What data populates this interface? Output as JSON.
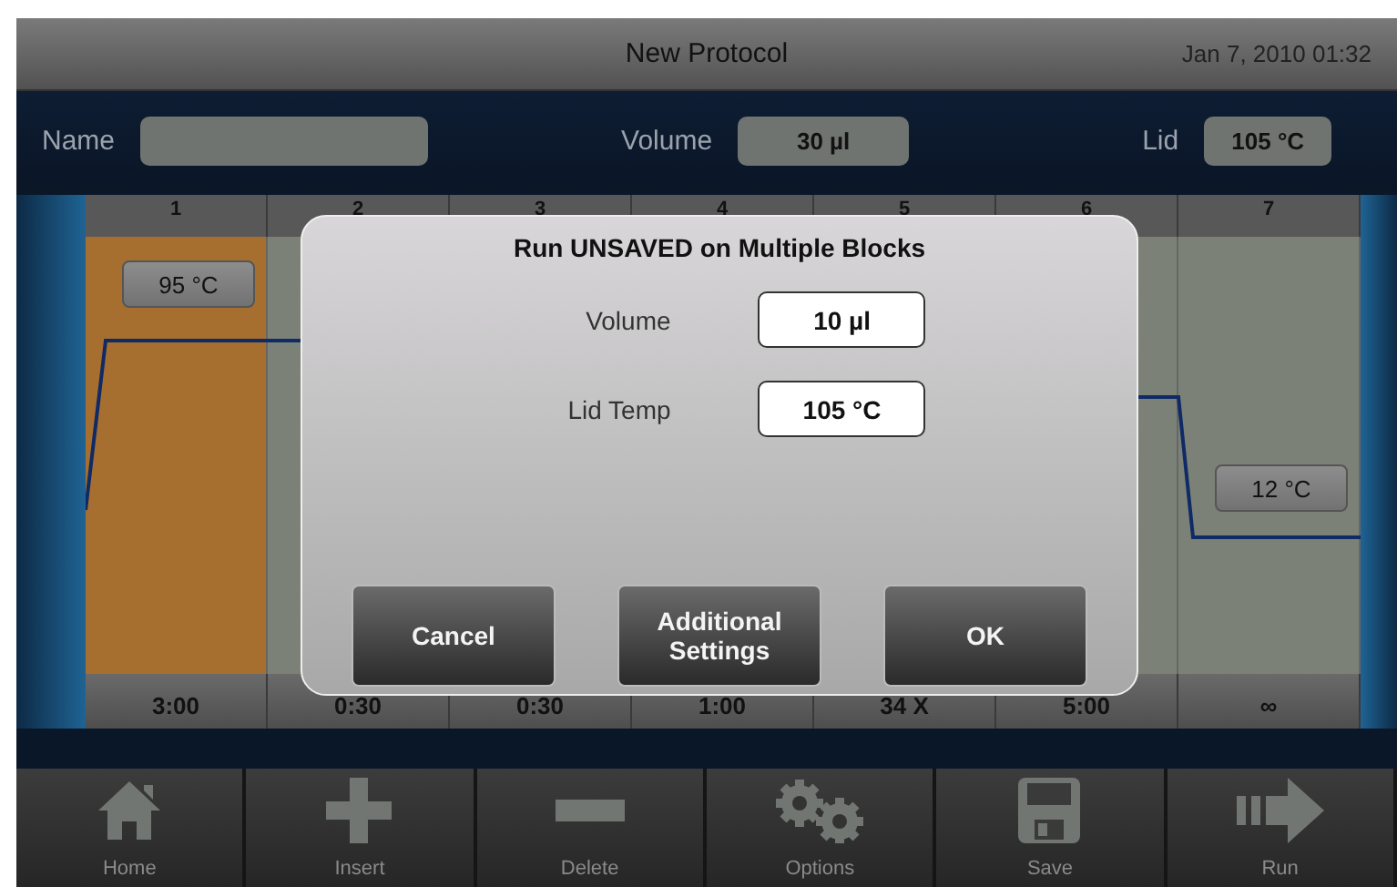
{
  "title_bar": {
    "title": "New Protocol",
    "datetime": "Jan 7, 2010 01:32"
  },
  "parameters": [
    {
      "label": "Name"
    },
    {
      "label": "Volume",
      "value": "30 µl"
    },
    {
      "label": "Lid",
      "value": "105 °C"
    }
  ],
  "steps": [
    {
      "number": "1",
      "temperature": "95 °C",
      "time": "3:00",
      "selected": true
    },
    {
      "number": "2",
      "time": "0:30",
      "selected": false
    },
    {
      "number": "3",
      "time": "0:30"
    },
    {
      "number": "4",
      "time": "1:00"
    },
    {
      "number": "5",
      "time": "34 X"
    },
    {
      "number": "6",
      "time": "5:00",
      "selected": false
    },
    {
      "number": "7",
      "temperature": "12 °C",
      "time": "∞",
      "selected": false
    }
  ],
  "dialog": {
    "title": "Run UNSAVED on Multiple Blocks",
    "fields": [
      {
        "label": "Volume",
        "value": "10 µl"
      },
      {
        "label": "Lid Temp",
        "value": "105 °C"
      }
    ],
    "buttons": [
      "Cancel",
      "Additional Settings",
      "OK"
    ]
  },
  "toolbar": [
    {
      "kind": "home",
      "label": "Home"
    },
    {
      "kind": "insert",
      "label": "Insert"
    },
    {
      "kind": "delete",
      "label": "Delete"
    },
    {
      "kind": "options",
      "label": "Options"
    },
    {
      "kind": "save",
      "label": "Save"
    },
    {
      "kind": "run",
      "label": "Run"
    }
  ]
}
